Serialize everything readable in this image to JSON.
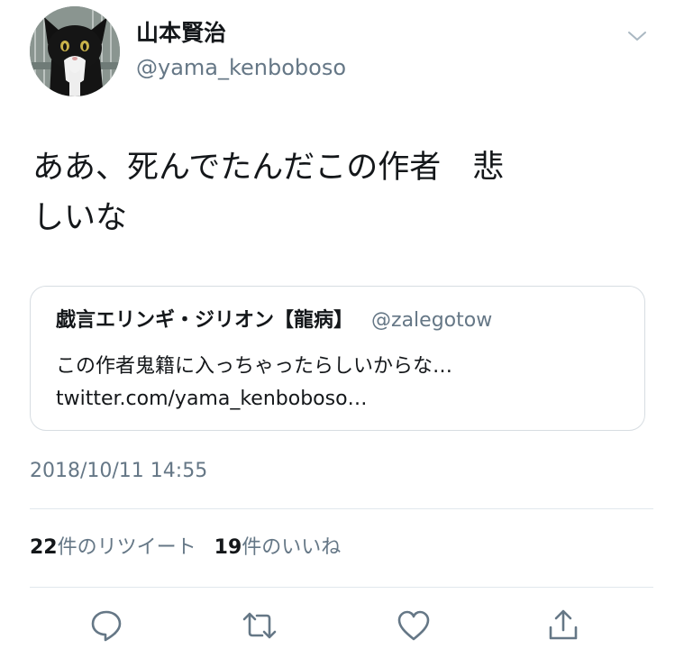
{
  "user": {
    "display_name": "山本賢治",
    "handle": "@yama_kenboboso"
  },
  "tweet": {
    "text": "ああ、死んでたんだこの作者　悲\nしいな",
    "timestamp": "2018/10/11 14:55"
  },
  "quote": {
    "author_name": "戯言エリンギ・ジリオン【龍病】",
    "author_handle": "@zalegotow",
    "text": "この作者鬼籍に入っちゃったらしいからな…",
    "link": "twitter.com/yama_kenboboso…"
  },
  "stats": {
    "retweets_count": "22",
    "retweets_label": "件のリツイート",
    "likes_count": "19",
    "likes_label": "件のいいね"
  },
  "icons": {
    "avatar": "cat-avatar",
    "menu": "chevron-down-icon",
    "reply": "reply-icon",
    "retweet": "retweet-icon",
    "like": "heart-icon",
    "share": "share-icon"
  },
  "colors": {
    "text_primary": "#14171a",
    "text_secondary": "#657786",
    "divider": "#e1e8ed",
    "card_border": "#d7dde2"
  }
}
